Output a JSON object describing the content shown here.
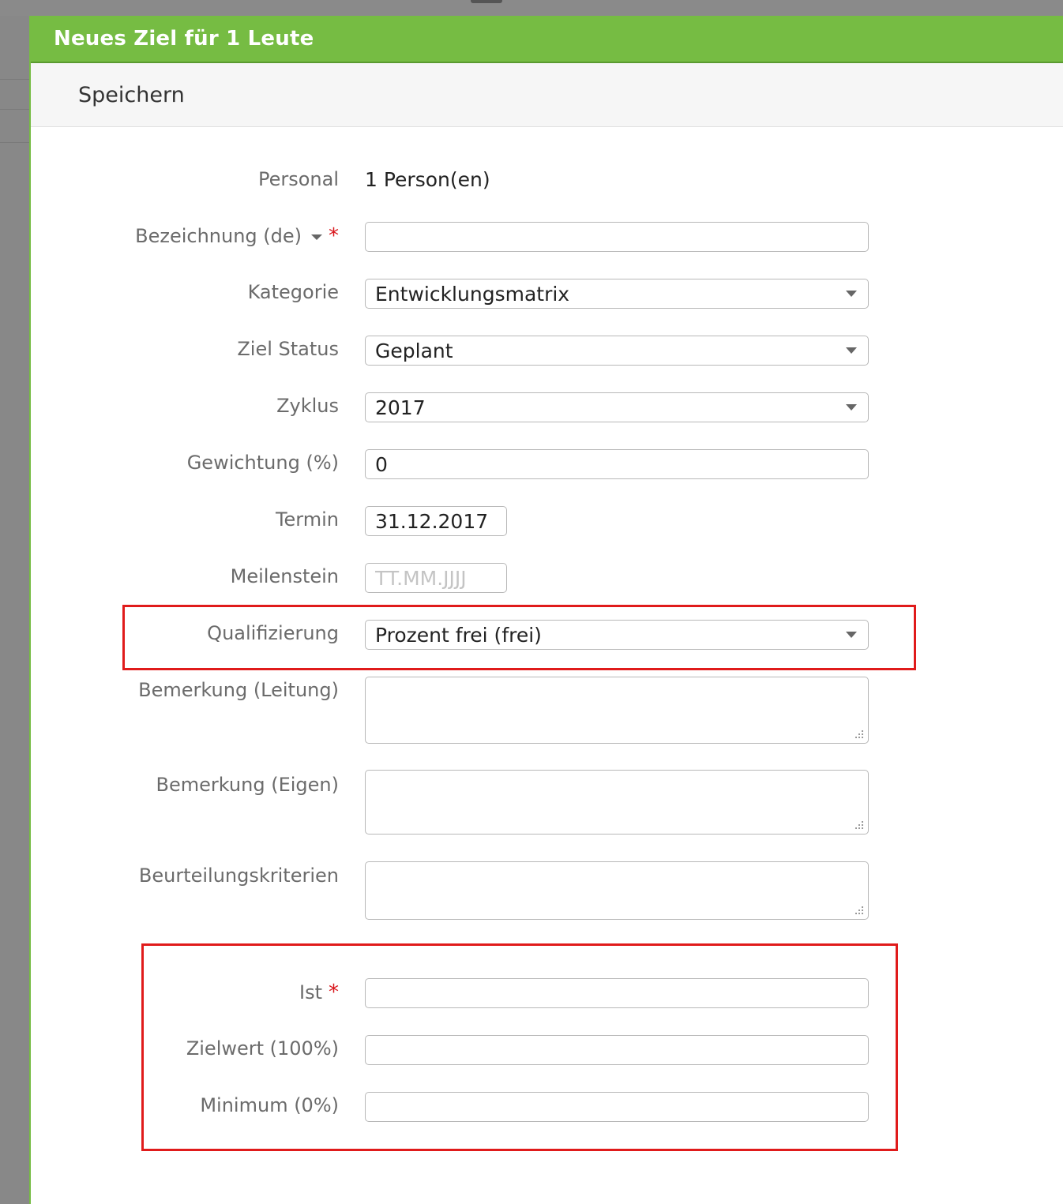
{
  "modal": {
    "title": "Neues Ziel für 1 Leute",
    "toolbar": {
      "save_label": "Speichern"
    }
  },
  "form": {
    "personal": {
      "label": "Personal",
      "value": "1 Person(en)"
    },
    "bezeichnung": {
      "label": "Bezeichnung (de)",
      "required_marker": "*",
      "value": ""
    },
    "kategorie": {
      "label": "Kategorie",
      "value": "Entwicklungsmatrix"
    },
    "ziel_status": {
      "label": "Ziel Status",
      "value": "Geplant"
    },
    "zyklus": {
      "label": "Zyklus",
      "value": "2017"
    },
    "gewichtung": {
      "label": "Gewichtung (%)",
      "value": "0"
    },
    "termin": {
      "label": "Termin",
      "value": "31.12.2017"
    },
    "meilenstein": {
      "label": "Meilenstein",
      "placeholder": "TT.MM.JJJJ"
    },
    "qualifizierung": {
      "label": "Qualifizierung",
      "value": "Prozent frei (frei)"
    },
    "bemerkung_leitung": {
      "label": "Bemerkung (Leitung)"
    },
    "bemerkung_eigen": {
      "label": "Bemerkung (Eigen)"
    },
    "beurteilungskriterien": {
      "label": "Beurteilungskriterien"
    },
    "ist": {
      "label": "Ist",
      "required_marker": "*",
      "value": ""
    },
    "zielwert": {
      "label": "Zielwert (100%)",
      "value": ""
    },
    "minimum": {
      "label": "Minimum (0%)",
      "value": ""
    }
  },
  "colors": {
    "header": "#76bc43",
    "highlight": "#e01b1b",
    "required": "#d9161c"
  },
  "icons": {
    "dropdown": "chevron-down-icon",
    "resize": "resize-grip-icon"
  }
}
